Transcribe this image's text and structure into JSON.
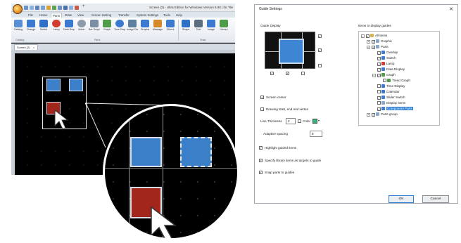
{
  "app": {
    "window_title": "Screen (2) - Ultra Edition for Windows Version 6.00 | for Tile",
    "quick_access_plus": "+",
    "menu_tabs": [
      "File",
      "Home",
      "Parts",
      "Draw",
      "View",
      "Screen Setting",
      "Transfer",
      "System Settings",
      "Tools",
      "Help"
    ],
    "active_tab_index": 2,
    "ribbon_buttons": [
      {
        "label": "Catalog",
        "color": "#5a8fd6"
      },
      {
        "label": "Change",
        "color": "#3c7ad0"
      },
      {
        "label": "Switch",
        "color": "#2f6fc6"
      },
      {
        "label": "Lamp",
        "color": "#d23c2f"
      },
      {
        "label": "Data Display",
        "color": "#3c7ad0"
      },
      {
        "label": "Meter",
        "color": "#8e9bab"
      },
      {
        "label": "Bar Graph",
        "color": "#7c8ea3"
      },
      {
        "label": "Graph",
        "color": "#4f9b47"
      },
      {
        "label": "Time Display",
        "color": "#3c7ad0"
      },
      {
        "label": "Image Display",
        "color": "#5f7f9f"
      },
      {
        "label": "Graphic",
        "color": "#3c7ad0"
      },
      {
        "label": "Message",
        "color": "#d48a2a"
      },
      {
        "label": "Others",
        "color": "#3c7ad0"
      },
      {
        "label": "Shape",
        "color": "#2f6fc6"
      },
      {
        "label": "Text",
        "color": "#5c6d80"
      },
      {
        "label": "Image",
        "color": "#3c7ad0"
      },
      {
        "label": "Library",
        "color": "#4f9b47"
      }
    ],
    "ribbon_groups": [
      "Catalog",
      "Parts",
      "Draw"
    ],
    "doc_tab_label": "Screen (2)",
    "doc_tab_close": "×"
  },
  "dialog": {
    "title": "Guide Settings",
    "close_glyph": "✕",
    "guide_display_label": "Guide Display",
    "screen_center": {
      "label": "Screen center",
      "checked": true
    },
    "drawing_points": {
      "label": "Drawing start, end and vertex",
      "checked": false
    },
    "line_thickness": {
      "label": "Line Thickness",
      "value": "2"
    },
    "color": {
      "label": "Color",
      "checked": false,
      "value": "#2db67a"
    },
    "adaptive_spacing": {
      "label": "Adaptive spacing",
      "value": "8"
    },
    "highlight_guided": {
      "label": "Highlight guided items",
      "checked": true
    },
    "specify_library": {
      "label": "Specify library items as targets to guide",
      "checked": true
    },
    "snap_parts": {
      "label": "Snap parts to guides",
      "checked": true
    },
    "items_label": "Items to display guides",
    "tree": [
      {
        "text": "All items",
        "checked": true,
        "level": 0,
        "color": "#d9b64b"
      },
      {
        "text": "Graphic",
        "checked": true,
        "level": 1,
        "color": "#8aa6c8"
      },
      {
        "text": "Parts",
        "checked": true,
        "level": 1,
        "color": "#8aa6c8"
      },
      {
        "text": "Overlap",
        "checked": true,
        "level": 2,
        "color": "#3c7ad0"
      },
      {
        "text": "Switch",
        "checked": true,
        "level": 2,
        "color": "#3c7ad0"
      },
      {
        "text": "Lamp",
        "checked": true,
        "level": 2,
        "color": "#d23c2f"
      },
      {
        "text": "Data Display",
        "checked": true,
        "level": 2,
        "color": "#3c7ad0"
      },
      {
        "text": "Graph",
        "checked": true,
        "level": 2,
        "color": "#4f9b47"
      },
      {
        "text": "Trend Graph",
        "checked": false,
        "level": 3,
        "color": "#4f9b47"
      },
      {
        "text": "Time Display",
        "checked": false,
        "level": 2,
        "color": "#3c7ad0"
      },
      {
        "text": "Calendar",
        "checked": false,
        "level": 2,
        "color": "#3c7ad0"
      },
      {
        "text": "Slider Switch",
        "checked": true,
        "level": 2,
        "color": "#3c7ad0"
      },
      {
        "text": "Display items",
        "checked": false,
        "level": 2,
        "color": "#8aa6c8"
      },
      {
        "text": "Component Parts",
        "checked": true,
        "level": 2,
        "color": "#3c7ad0",
        "selected": true
      },
      {
        "text": "Parts group",
        "checked": true,
        "level": 1,
        "color": "#8aa6c8"
      }
    ],
    "ok_label": "OK",
    "cancel_label": "Cancel"
  }
}
